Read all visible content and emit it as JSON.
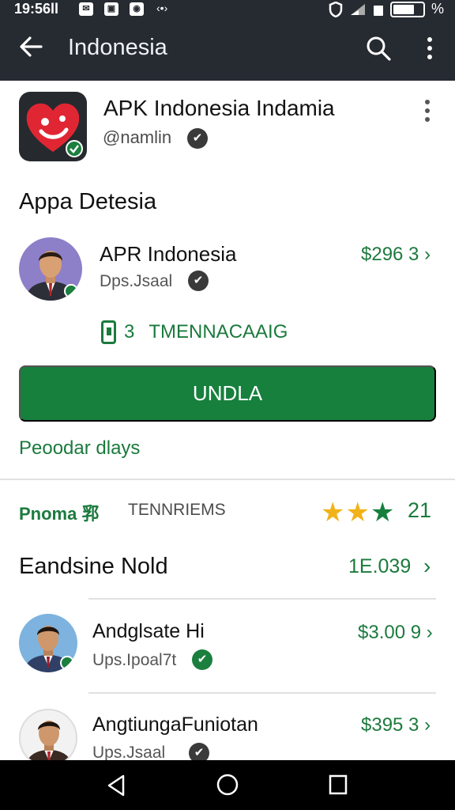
{
  "status_bar": {
    "time": "19:56ll",
    "notif_icons": [
      "app-icon",
      "app-icon",
      "app-icon"
    ],
    "signal_text": "%"
  },
  "app_bar": {
    "title": "Indonesia"
  },
  "app": {
    "title": "APK Indonesia Indamia",
    "handle": "@namlin"
  },
  "section": {
    "heading": "Appa Detesia"
  },
  "developer": {
    "name": "APR Indonesia",
    "subtitle": "Dps.Jsaal",
    "price": "$296 3 ›",
    "badge_count": "3",
    "badge_text": "TMENNACAAIG"
  },
  "install_button": {
    "label": "UNDLA"
  },
  "link": {
    "label": "Peoodar dlays"
  },
  "rating": {
    "label": "Pnoma 郛",
    "category": "TENNRIEMS",
    "stars": 3,
    "value": "21"
  },
  "list": {
    "heading": "Eandsine Nold",
    "count": "1E.039",
    "items": [
      {
        "name": "Andglsate Hi",
        "subtitle": "Ups.Ipoal7t",
        "price": "$3.00 9 ›"
      },
      {
        "name": "AngtiungaFuniotan",
        "subtitle": "Ups.Jsaal",
        "price": "$395 3 ›"
      }
    ]
  },
  "colors": {
    "appbar_bg": "#262a31",
    "accent_green": "#17803d",
    "star_gold": "#f2b21a"
  }
}
